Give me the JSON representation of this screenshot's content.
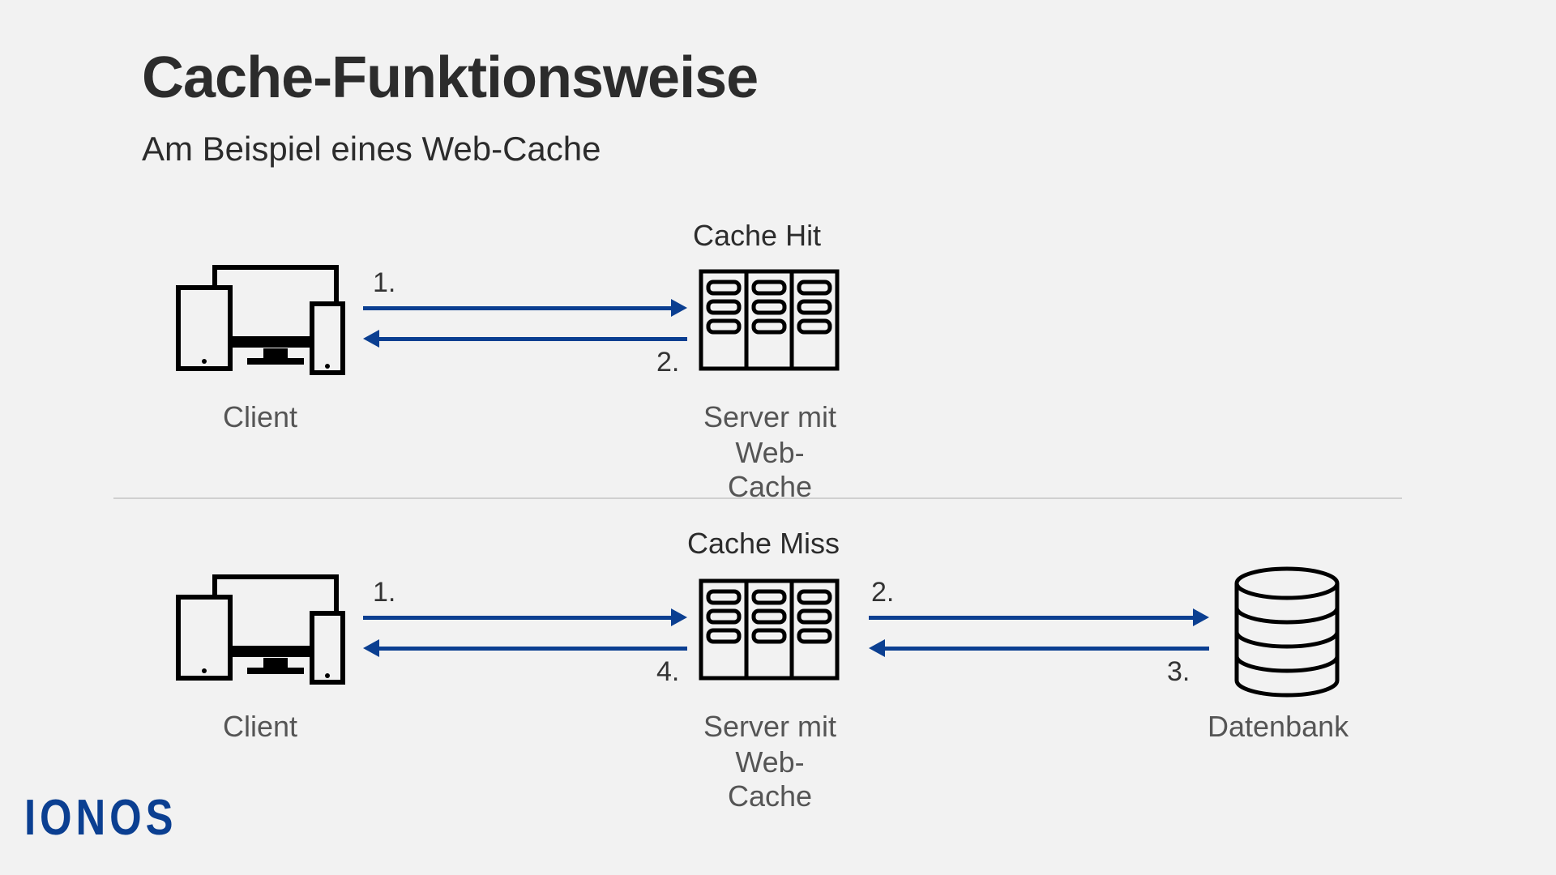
{
  "title": "Cache-Funktionsweise",
  "subtitle": "Am Beispiel eines Web-Cache",
  "brand": "IONOS",
  "colors": {
    "accent": "#0b3f91"
  },
  "scenario_hit": {
    "header": "Cache Hit",
    "client_label": "Client",
    "server_label_line1": "Server mit",
    "server_label_line2": "Web-Cache",
    "step1": "1.",
    "step2": "2."
  },
  "scenario_miss": {
    "header": "Cache Miss",
    "client_label": "Client",
    "server_label_line1": "Server mit",
    "server_label_line2": "Web-Cache",
    "db_label": "Datenbank",
    "step1": "1.",
    "step2": "2.",
    "step3": "3.",
    "step4": "4."
  }
}
